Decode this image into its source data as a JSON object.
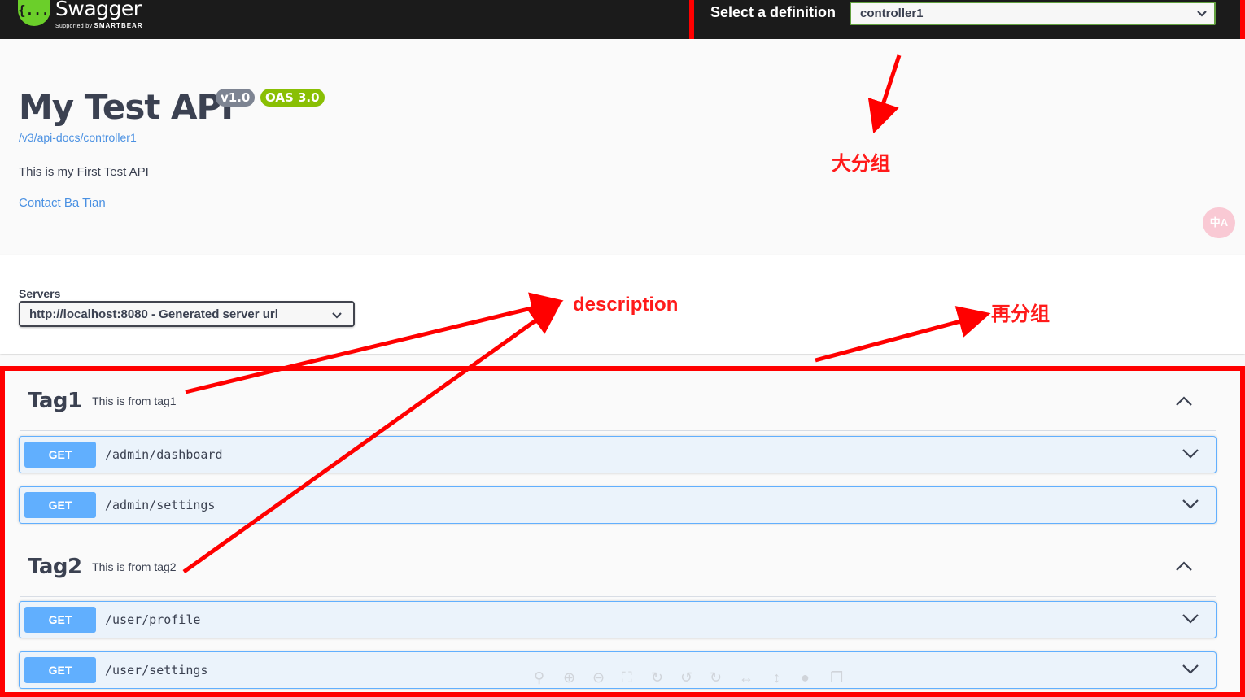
{
  "topbar": {
    "logo_symbol": "{...}",
    "logo_title": "Swagger",
    "logo_sub_prefix": "Supported by",
    "logo_sub_brand": "SMARTBEAR",
    "definition_label": "Select a definition",
    "definition_value": "controller1"
  },
  "info": {
    "title": "My Test API",
    "version": "v1.0",
    "oas": "OAS 3.0",
    "spec_url": "/v3/api-docs/controller1",
    "description": "This is my First Test API",
    "contact": "Contact Ba Tian",
    "translate_icon_text": "中A"
  },
  "servers": {
    "label": "Servers",
    "selected": "http://localhost:8080 - Generated server url"
  },
  "tags": [
    {
      "name": "Tag1",
      "description": "This is from tag1",
      "operations": [
        {
          "method": "GET",
          "path": "/admin/dashboard"
        },
        {
          "method": "GET",
          "path": "/admin/settings"
        }
      ]
    },
    {
      "name": "Tag2",
      "description": "This is from tag2",
      "operations": [
        {
          "method": "GET",
          "path": "/user/profile"
        },
        {
          "method": "GET",
          "path": "/user/settings"
        }
      ]
    }
  ],
  "annotations": {
    "definition_group": "大分组",
    "description": "description",
    "sub_group": "再分组"
  },
  "viewer": {
    "pager": "",
    "tools": [
      "zoom-fit-icon",
      "zoom-in-icon",
      "zoom-out-icon",
      "fullscreen-icon",
      "refresh-icon",
      "rotate-left-icon",
      "rotate-right-icon",
      "flip-horizontal-icon",
      "flip-vertical-icon",
      "droplet-icon",
      "copy-icon"
    ]
  },
  "colors": {
    "topbar_bg": "#1b1b1b",
    "swagger_green": "#6bcf2a",
    "get_blue": "#61affe",
    "get_bg": "#ebf3fb",
    "annotation_red": "#ff0000",
    "link_blue": "#4990e2",
    "oas_green": "#89bf04",
    "version_gray": "#7d8492"
  }
}
